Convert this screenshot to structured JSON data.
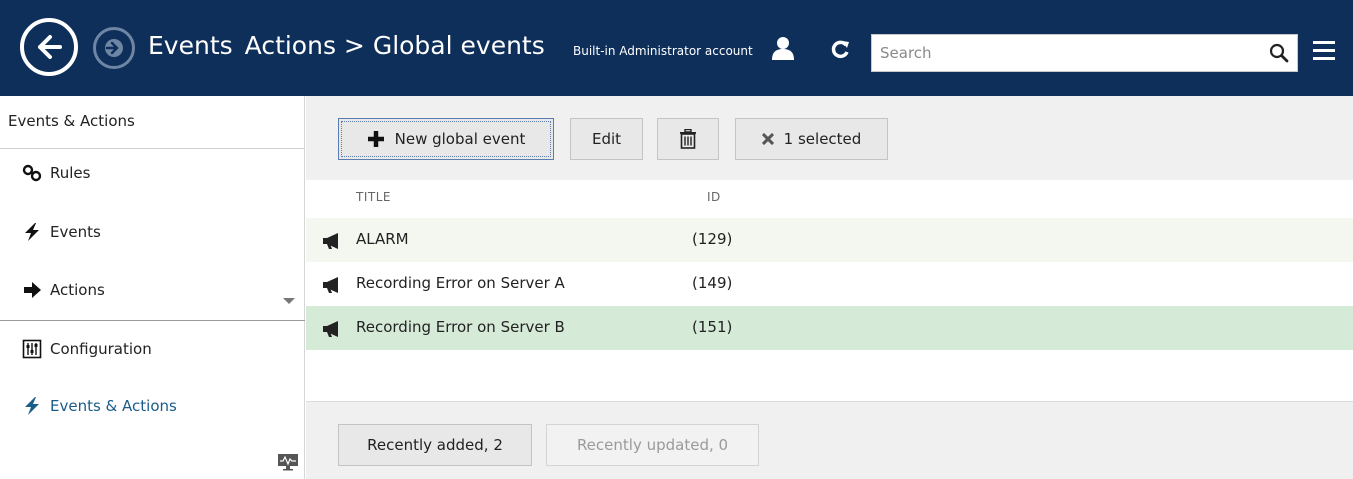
{
  "header": {
    "breadcrumb": [
      "Events",
      "Actions > Global events"
    ],
    "account": "Built-in Administrator account",
    "search_placeholder": "Search",
    "icons": [
      "back-arrow-icon",
      "forward-arrow-icon",
      "user-icon",
      "refresh-icon",
      "search-icon",
      "menu-icon"
    ],
    "background_color": "#0e2f5a"
  },
  "sidebar": {
    "title": "Events & Actions",
    "items": [
      {
        "label": "Rules",
        "icon": "link-icon"
      },
      {
        "label": "Events",
        "icon": "lightning-icon"
      },
      {
        "label": "Actions",
        "icon": "arrow-right-icon"
      }
    ],
    "sections": [
      {
        "label": "Configuration",
        "icon": "sliders-icon"
      },
      {
        "label": "Events & Actions",
        "icon": "lightning-icon",
        "active": true
      }
    ]
  },
  "toolbar": {
    "new_label": "New global event",
    "edit_label": "Edit",
    "selected_label": "1 selected"
  },
  "table": {
    "columns": [
      "TITLE",
      "ID"
    ],
    "rows": [
      {
        "title": "ALARM",
        "id": "(129)"
      },
      {
        "title": "Recording Error on Server A",
        "id": "(149)"
      },
      {
        "title": "Recording Error on Server B",
        "id": "(151)",
        "selected": true
      }
    ]
  },
  "footer": {
    "recently_added": "Recently added, 2",
    "recently_updated": "Recently updated, 0"
  }
}
